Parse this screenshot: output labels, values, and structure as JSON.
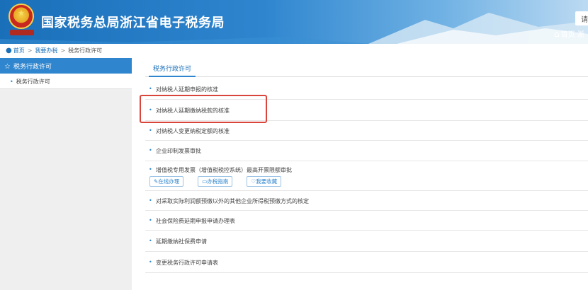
{
  "header": {
    "title": "国家税务总局浙江省电子税务局",
    "search_stub": "请",
    "home_label": "首页",
    "home_extra": "浙"
  },
  "breadcrumb": {
    "items": [
      "首页",
      "我要办税",
      "税务行政许可"
    ]
  },
  "sidebar": {
    "heading": "税务行政许可",
    "items": [
      {
        "label": "税务行政许可"
      }
    ]
  },
  "main": {
    "tab_label": "税务行政许可",
    "items": [
      {
        "label": "对纳税人延期申报的核准"
      },
      {
        "label": "对纳税人延期缴纳税款的核准"
      },
      {
        "label": "对纳税人变更纳税定额的核准"
      },
      {
        "label": "企业印制发票审批"
      },
      {
        "label": "增值税专用发票（增值税税控系统）最高开票限额审批"
      },
      {
        "label": "对采取实际利润额预缴以外的其他企业所得税预缴方式的核定"
      },
      {
        "label": "社会保险费延期申报申请办理表"
      },
      {
        "label": "延期缴纳社保费申请"
      },
      {
        "label": "变更税务行政许可申请表"
      }
    ],
    "actions": {
      "online": "在线办理",
      "guide": "办税指南",
      "favorite": "我要收藏"
    }
  },
  "colors": {
    "accent": "#2f86cf",
    "highlight": "#d9453a"
  }
}
